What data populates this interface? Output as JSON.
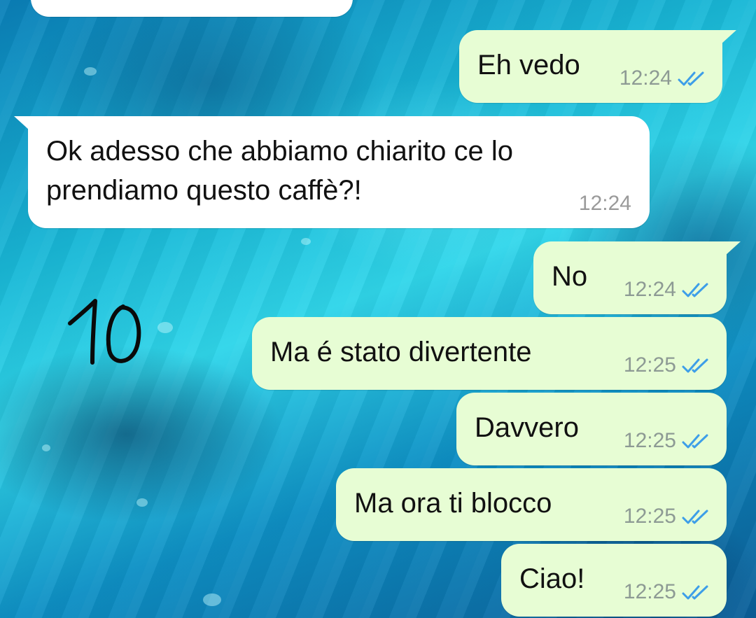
{
  "chat": {
    "colors": {
      "outgoing_bubble": "#e7fdd4",
      "incoming_bubble": "#ffffff",
      "read_ticks": "#3d9ee8",
      "timestamp": "#8d9a94"
    },
    "messages": [
      {
        "id": "m1",
        "direction": "outgoing",
        "text": "Eh vedo",
        "time": "12:24",
        "status_icon": "double-check-icon"
      },
      {
        "id": "m2",
        "direction": "incoming",
        "text_line1": "Ok adesso che abbiamo chiarito ce lo",
        "text_line2": "prendiamo questo caffè?!",
        "time": "12:24"
      },
      {
        "id": "m3",
        "direction": "outgoing",
        "text": "No",
        "time": "12:24",
        "status_icon": "double-check-icon"
      },
      {
        "id": "m4",
        "direction": "outgoing",
        "text": "Ma é stato divertente",
        "time": "12:25",
        "status_icon": "double-check-icon"
      },
      {
        "id": "m5",
        "direction": "outgoing",
        "text": "Davvero",
        "time": "12:25",
        "status_icon": "double-check-icon"
      },
      {
        "id": "m6",
        "direction": "outgoing",
        "text": "Ma ora ti blocco",
        "time": "12:25",
        "status_icon": "double-check-icon"
      },
      {
        "id": "m7",
        "direction": "outgoing",
        "text": "Ciao!",
        "time": "12:25",
        "status_icon": "double-check-icon"
      }
    ]
  },
  "annotation": {
    "handwritten_text": "10"
  }
}
